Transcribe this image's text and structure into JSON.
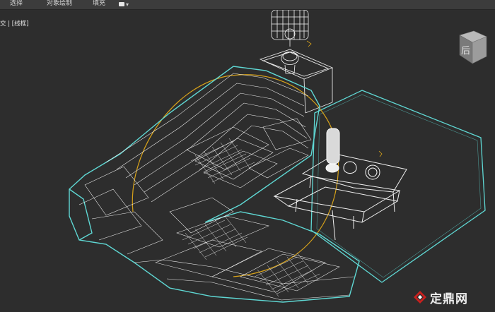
{
  "menubar": {
    "items": [
      {
        "label": "选择"
      },
      {
        "label": "对象绘制"
      },
      {
        "label": "填充"
      }
    ],
    "viewport_dropdown_caret": "▾"
  },
  "viewport": {
    "label": "交 | [线框]",
    "viewcube_face": "后"
  },
  "watermark": {
    "text": "定鼎网",
    "brand_color": "#c8201e"
  },
  "colors": {
    "background": "#2d2d2d",
    "wire_white": "#ffffff",
    "wire_cyan": "#5fd8d4",
    "gizmo_orange": "#d7a21a"
  }
}
